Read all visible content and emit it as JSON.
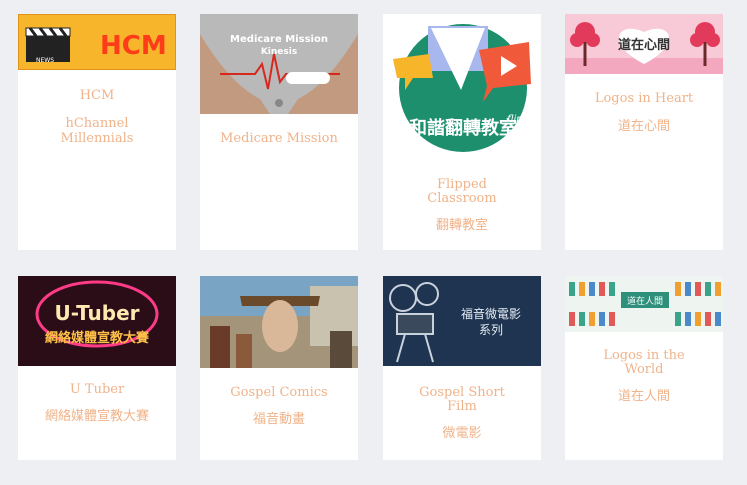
{
  "cards": [
    {
      "title": "HCM",
      "subtitle": "hChannel Millennials",
      "thumb_text": "HCM",
      "thumb_label": "NEWS"
    },
    {
      "title": "Medicare Mission",
      "subtitle": "",
      "thumb_text": "Medicare Mission",
      "thumb_label": "Kinesis"
    },
    {
      "title": "Flipped Classroom",
      "subtitle": "翻轉教室",
      "thumb_text": "和諧翻轉教室",
      "thumb_label": "flip"
    },
    {
      "title": "Logos in Heart",
      "subtitle": "道在心間",
      "thumb_text": "道在心間"
    },
    {
      "title": "U Tuber",
      "subtitle": "網絡媒體宣教大賽",
      "thumb_text": "U-Tuber",
      "thumb_label": "網絡媒體宣教大賽"
    },
    {
      "title": "Gospel Comics",
      "subtitle": "福音動畫"
    },
    {
      "title": "Gospel Short Film",
      "subtitle": "微電影",
      "thumb_text": "福音微電影",
      "thumb_label": "系列"
    },
    {
      "title": "Logos in the World",
      "subtitle": "道在人間",
      "thumb_text": "道在人間"
    }
  ],
  "colors": {
    "page_bg": "#eeeff3",
    "card_bg": "#ffffff",
    "text_accent": "#f0b38a"
  }
}
